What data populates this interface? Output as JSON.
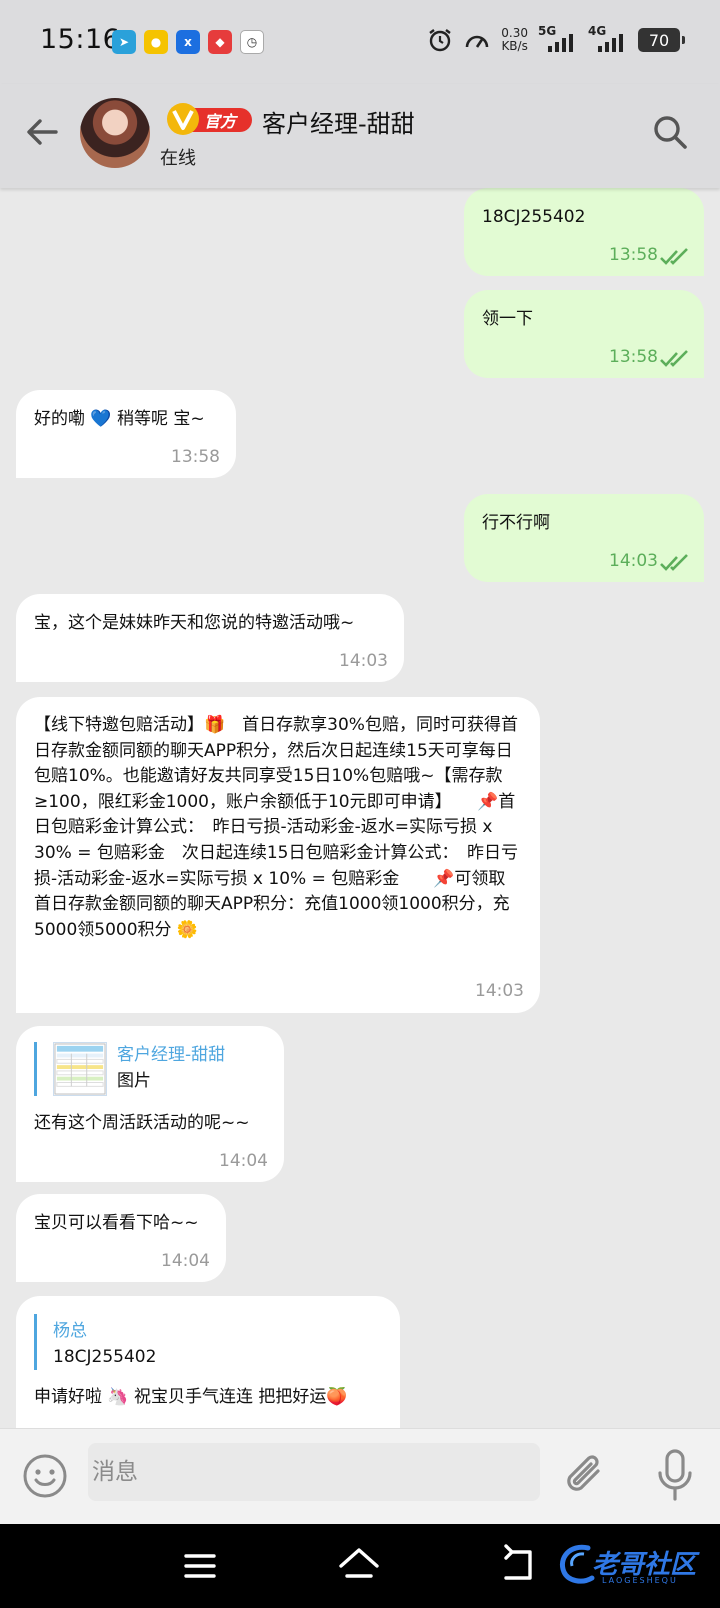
{
  "status_bar": {
    "time": "15:16",
    "net_speed_value": "0.30",
    "net_speed_unit": "KB/s",
    "sim1_label": "5G",
    "sim2_label": "4G",
    "battery": "70",
    "app_icons": [
      "telegram-icon",
      "app-yellow-icon",
      "x-app-icon",
      "app-red-icon",
      "clock-app-icon"
    ]
  },
  "header": {
    "title": "客户经理-甜甜",
    "subtitle": "在线",
    "badge": "官方",
    "accent_color": "#4ea6df"
  },
  "messages": [
    {
      "direction": "out",
      "text": "18CJ255402",
      "time": "13:58",
      "read": true
    },
    {
      "direction": "out",
      "text": "领一下",
      "time": "13:58",
      "read": true
    },
    {
      "direction": "in",
      "text": "好的嘞 💙 稍等呢 宝~",
      "time": "13:58"
    },
    {
      "direction": "out",
      "text": "行不行啊",
      "time": "14:03",
      "read": true
    },
    {
      "direction": "in",
      "text": "宝，这个是妹妹昨天和您说的特邀活动哦~",
      "time": "14:03"
    },
    {
      "direction": "in",
      "text": "【线下特邀包赔活动】🎁　首日存款享30%包赔，同时可获得首日存款金额同额的聊天APP积分，然后次日起连续15天可享每日包赔10%。也能邀请好友共同享受15日10%包赔哦~【需存款≥100，限红彩金1000，账户余额低于10元即可申请】　　📌首日包赔彩金计算公式：　昨日亏损-活动彩金-返水=实际亏损 x 30% = 包赔彩金　次日起连续15日包赔彩金计算公式：　昨日亏损-活动彩金-返水=实际亏损 x 10% = 包赔彩金　　📌可领取首日存款金额同额的聊天APP积分：充值1000领1000积分，充5000领5000积分 🌼",
      "time": "14:03"
    },
    {
      "direction": "in",
      "quote_name": "客户经理-甜甜",
      "quote_text": "图片",
      "text": "还有这个周活跃活动的呢~~",
      "time": "14:04"
    },
    {
      "direction": "in",
      "text": "宝贝可以看看下哈~~",
      "time": "14:04"
    },
    {
      "direction": "in",
      "quote_name": "杨总",
      "quote_text": "18CJ255402",
      "text": "申请好啦 🦄 祝宝贝手气连连 把把好运🍑",
      "time": ""
    }
  ],
  "composer": {
    "placeholder": "消息"
  },
  "watermark": {
    "text": "老哥社区",
    "sub": "LAOGESHEQU"
  }
}
